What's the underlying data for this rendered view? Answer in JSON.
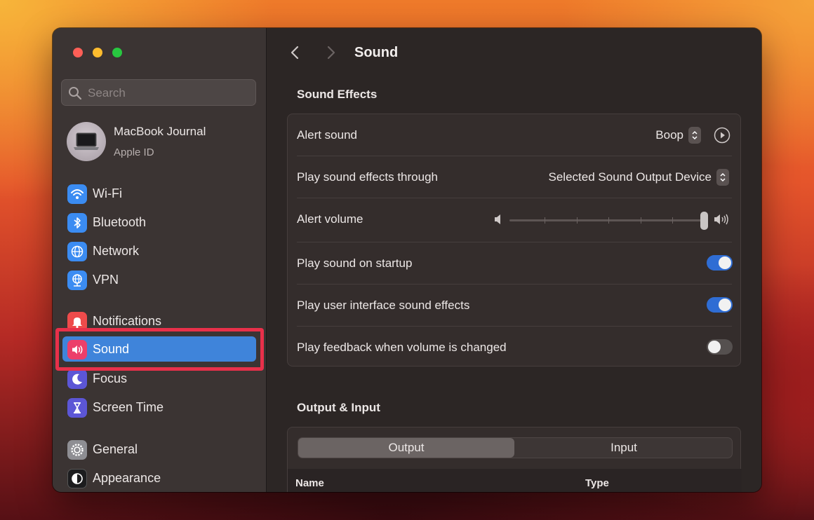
{
  "sidebar": {
    "search_placeholder": "Search",
    "account": {
      "name": "MacBook Journal",
      "subtitle": "Apple ID"
    },
    "items": [
      {
        "label": "Wi-Fi",
        "icon": "wifi-icon",
        "color": "#3b8cf2"
      },
      {
        "label": "Bluetooth",
        "icon": "bluetooth-icon",
        "color": "#3b8cf2"
      },
      {
        "label": "Network",
        "icon": "globe-icon",
        "color": "#3b8cf2"
      },
      {
        "label": "VPN",
        "icon": "vpn-globe-icon",
        "color": "#3b8cf2"
      },
      {
        "label": "Notifications",
        "icon": "bell-icon",
        "color": "#ee4b4b"
      },
      {
        "label": "Sound",
        "icon": "speaker-icon",
        "color": "#ec3f6a",
        "selected": true
      },
      {
        "label": "Focus",
        "icon": "moon-icon",
        "color": "#5c56d6"
      },
      {
        "label": "Screen Time",
        "icon": "hourglass-icon",
        "color": "#5c56d6"
      },
      {
        "label": "General",
        "icon": "gear-icon",
        "color": "#8e8e93"
      },
      {
        "label": "Appearance",
        "icon": "appearance-icon",
        "color": "#1c1c1e"
      }
    ]
  },
  "header": {
    "title": "Sound"
  },
  "sound_effects": {
    "title": "Sound Effects",
    "alert_sound": {
      "label": "Alert sound",
      "value": "Boop"
    },
    "play_through": {
      "label": "Play sound effects through",
      "value": "Selected Sound Output Device"
    },
    "alert_volume": {
      "label": "Alert volume",
      "level": 1.0
    },
    "startup": {
      "label": "Play sound on startup",
      "on": true
    },
    "ui_effects": {
      "label": "Play user interface sound effects",
      "on": true
    },
    "feedback": {
      "label": "Play feedback when volume is changed",
      "on": false
    }
  },
  "output_input": {
    "title": "Output & Input",
    "tabs": [
      "Output",
      "Input"
    ],
    "active_tab": "Output",
    "columns": [
      "Name",
      "Type"
    ]
  },
  "colors": {
    "accent": "#3f84da",
    "toggle_on": "#2f6dd4",
    "highlight_box": "#e8304a"
  }
}
